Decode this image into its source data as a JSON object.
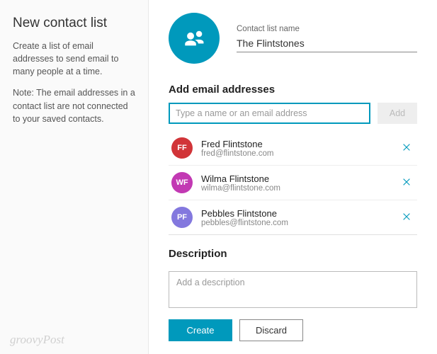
{
  "left": {
    "title": "New contact list",
    "help1": "Create a list of email addresses to send email to many people at a time.",
    "help2": "Note: The email addresses in a contact list are not connected to your saved contacts."
  },
  "header": {
    "name_label": "Contact list name",
    "name_value": "The Flintstones"
  },
  "add_section": {
    "heading": "Add email addresses",
    "placeholder": "Type a name or an email address",
    "add_label": "Add"
  },
  "contacts": [
    {
      "initials": "FF",
      "color": "#d13438",
      "name": "Fred Flintstone",
      "email": "fred@flintstone.com"
    },
    {
      "initials": "WF",
      "color": "#c239b3",
      "name": "Wilma Flintstone",
      "email": "wilma@flintstone.com"
    },
    {
      "initials": "PF",
      "color": "#8378de",
      "name": "Pebbles Flintstone",
      "email": "pebbles@flintstone.com"
    }
  ],
  "description": {
    "heading": "Description",
    "placeholder": "Add a description"
  },
  "actions": {
    "create": "Create",
    "discard": "Discard"
  },
  "watermark": "groovyPost"
}
